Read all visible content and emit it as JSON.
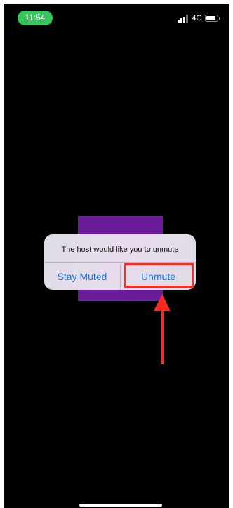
{
  "status_bar": {
    "time": "11:54",
    "network": "4G",
    "signal_bars_active": 3,
    "signal_bars_total": 4,
    "battery_level": 0.85
  },
  "alert": {
    "message": "The host would like you to unmute",
    "stay_muted_label": "Stay Muted",
    "unmute_label": "Unmute"
  },
  "colors": {
    "background": "#000000",
    "video_tile": "#6a1b9a",
    "button_text": "#1a73e8",
    "annotation": "#ff2a1f",
    "time_pill": "#34c759"
  },
  "icons": {
    "signal": "signal-icon",
    "battery": "battery-icon",
    "arrow": "arrow-up-icon"
  }
}
